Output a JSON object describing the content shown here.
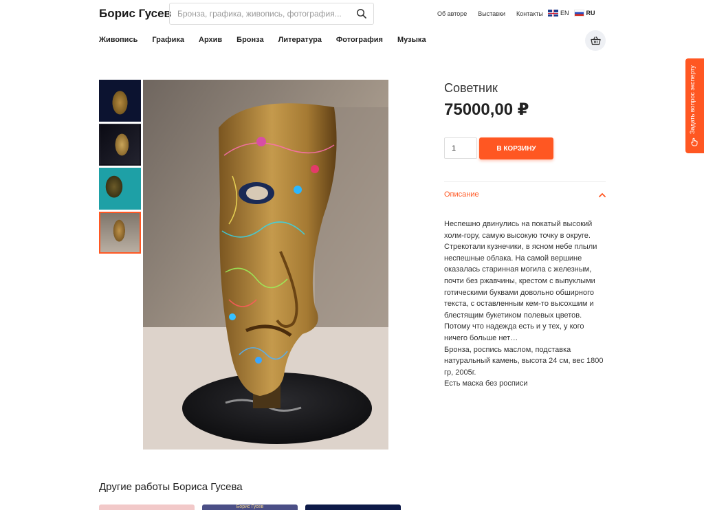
{
  "header": {
    "brand": "Борис Гусев",
    "search_placeholder": "Бронза, графика, живопись, фотография...",
    "top_links": [
      "Об авторе",
      "Выставки",
      "Контакты"
    ],
    "languages": [
      {
        "code": "EN",
        "active": false
      },
      {
        "code": "RU",
        "active": true
      }
    ]
  },
  "nav": {
    "items": [
      "Живопись",
      "Графика",
      "Архив",
      "Бронза",
      "Литература",
      "Фотография",
      "Музыка"
    ]
  },
  "product": {
    "title": "Советник",
    "price": "75000,00 ₽",
    "quantity": "1",
    "add_to_cart_label": "В КОРЗИНУ",
    "description_tab": "Описание",
    "description_lines": [
      "Неспешно двинулись на покатый высокий холм-гору, самую высокую точку в округе. Стрекотали кузнечики, в ясном небе плыли неспешные облака. На самой вершине оказалась старинная могила с железным, почти без ржавчины, крестом с выпуклыми готическими буквами довольно обширного текста, с оставленным кем-то высохшим и блестящим букетиком полевых цветов. Потому что надежда есть и у тех, у кого ничего больше нет…",
      "Бронза, роспись маслом, подставка натуральный камень, высота 24 см, вес 1800 гр, 2005г.",
      "Есть маска без росписи"
    ],
    "thumbnails_count": 4,
    "active_thumbnail": 4
  },
  "expert_tab": {
    "label": "Задать вопрос эксперту"
  },
  "related": {
    "heading": "Другие работы Бориса Гусева",
    "card2_text": "Борис Гусев"
  },
  "colors": {
    "accent": "#ff5722",
    "text": "#222222"
  }
}
